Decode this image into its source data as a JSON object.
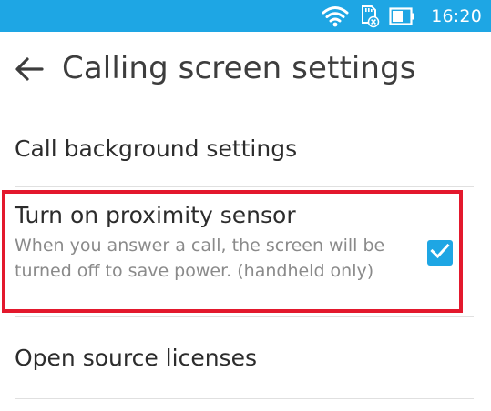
{
  "status_bar": {
    "time": "16:20",
    "icons": [
      "wifi-icon",
      "sd-card-icon",
      "battery-icon"
    ],
    "color": "#1ea6e4"
  },
  "app_bar": {
    "title": "Calling screen settings",
    "back_icon": "arrow-back-icon"
  },
  "settings": {
    "call_background": {
      "title": "Call background settings"
    },
    "proximity_sensor": {
      "title": "Turn on proximity sensor",
      "summary": "When you answer a call, the screen will be turned off to save power. (handheld only)",
      "checked": true,
      "highlight_color": "#e3182d"
    },
    "open_source": {
      "title": "Open source licenses"
    }
  },
  "colors": {
    "accent": "#1ea6e4",
    "title_text": "#2c2c2c",
    "summary_text": "#8a8a8a"
  }
}
